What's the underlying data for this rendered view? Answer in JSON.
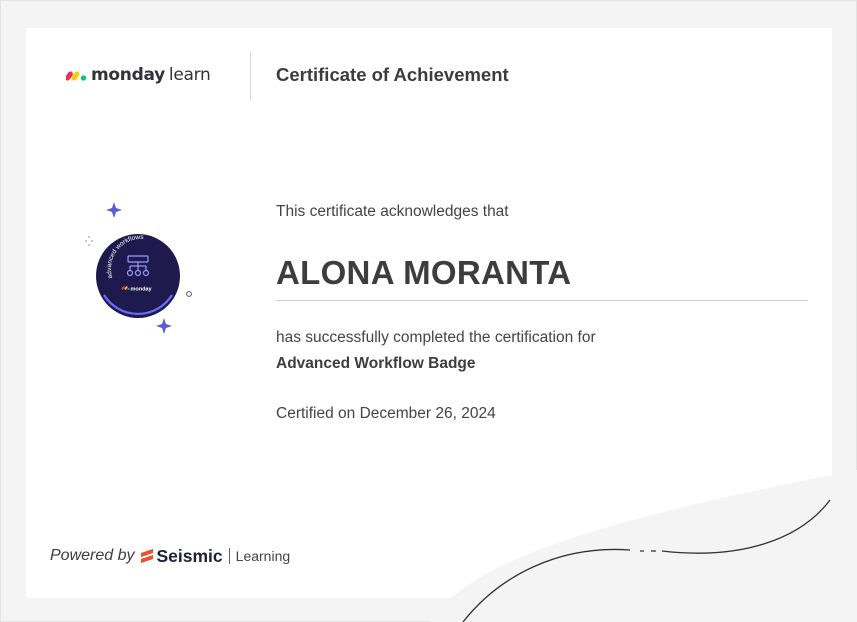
{
  "brand": {
    "logo_bold": "monday",
    "logo_light": "learn",
    "colors": {
      "red": "#f62b54",
      "yellow": "#ffcc00",
      "green": "#00ca72"
    }
  },
  "header": {
    "title": "Certificate of Achievement"
  },
  "badge": {
    "arc_text": "advanced workflows",
    "logo_text": "monday",
    "icon": "workflow-diagram-icon",
    "colors": {
      "disc": "#1e1a4d",
      "ring": "#6c6cff",
      "sparkle": "#5b5bd6"
    }
  },
  "body": {
    "acknowledges": "This certificate acknowledges that",
    "recipient": "ALONA MORANTA",
    "completed": "has successfully completed the certification for",
    "certification": "Advanced Workflow Badge",
    "certified_on": "Certified on December 26, 2024"
  },
  "footer": {
    "powered_by": "Powered by",
    "seismic": "Seismic",
    "learning": "Learning",
    "seismic_color": "#f04e23"
  }
}
